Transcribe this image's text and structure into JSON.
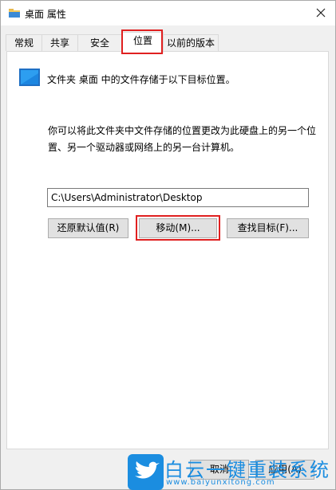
{
  "window": {
    "title": "桌面 属性",
    "close_symbol": "✕"
  },
  "tabs": [
    {
      "label": "常规"
    },
    {
      "label": "共享"
    },
    {
      "label": "安全"
    },
    {
      "label": "位置",
      "active": true
    },
    {
      "label": "以前的版本"
    }
  ],
  "location": {
    "info_line": "文件夹 桌面 中的文件存储于以下目标位置。",
    "description": "你可以将此文件夹中文件存储的位置更改为此硬盘上的另一个位置、另一个驱动器或网络上的另一台计算机。",
    "path_value": "C:\\Users\\Administrator\\Desktop"
  },
  "buttons": {
    "restore_default": "还原默认值(R)",
    "move": "移动(M)...",
    "find_target": "查找目标(F)..."
  },
  "footer": {
    "cancel": "取消",
    "apply": "应用(A)"
  },
  "watermark": {
    "title": "白云一键重装系统",
    "url": "www.baiyunxitong.com"
  },
  "colors": {
    "highlight": "#e02020",
    "brand_blue": "#1b8de0"
  }
}
